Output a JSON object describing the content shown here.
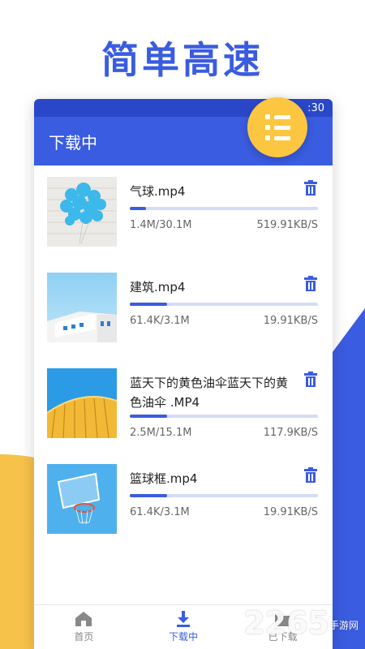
{
  "headline": "简单高速",
  "status": {
    "time": ":30"
  },
  "appbar": {
    "title": "下载中"
  },
  "downloads": [
    {
      "name": "气球.mp4",
      "size": "1.4M/30.1M",
      "speed": "519.91KB/S",
      "progress": 0.047
    },
    {
      "name": "建筑.mp4",
      "size": "61.4K/3.1M",
      "speed": "19.91KB/S",
      "progress": 0.2
    },
    {
      "name": "蓝天下的黄色油伞蓝天下的黄色油伞 .MP4",
      "size": "2.5M/15.1M",
      "speed": "117.9KB/S",
      "progress": 0.2
    },
    {
      "name": "篮球框.mp4",
      "size": "61.4K/3.1M",
      "speed": "19.91KB/S",
      "progress": 0.2
    }
  ],
  "tabs": {
    "home": "首页",
    "downloading": "下载中",
    "downloaded": "已下载"
  },
  "watermark": {
    "brand": "2265",
    "tag": "手游网"
  },
  "colors": {
    "accent": "#3a5ce0",
    "fab": "#fcc640"
  },
  "icons": [
    "menu-icon",
    "trash-icon",
    "home-icon",
    "download-icon",
    "folder-icon",
    "wifi-icon"
  ]
}
